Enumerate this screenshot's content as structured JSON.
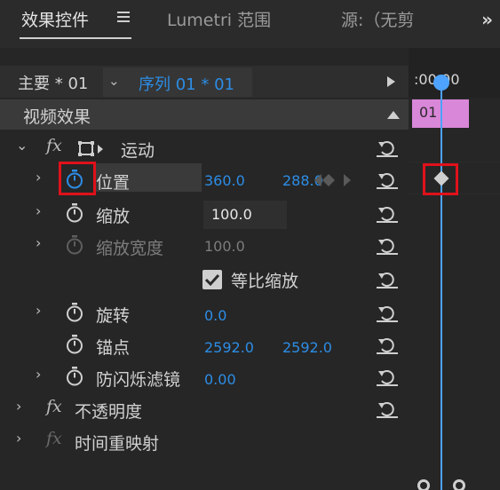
{
  "tabs": {
    "effect_controls": "效果控件",
    "lumetri": "Lumetri 范围",
    "source": "源:（无剪"
  },
  "sequence_bar": {
    "master": "主要 * 01",
    "sequence": "序列 01 * 01"
  },
  "video_effects": {
    "header": "视频效果",
    "motion": {
      "label": "运动",
      "properties": {
        "position": {
          "label": "位置",
          "x": "360.0",
          "y": "288.0"
        },
        "scale": {
          "label": "缩放",
          "value": "100.0"
        },
        "scale_width": {
          "label": "缩放宽度",
          "value": "100.0"
        },
        "uniform_scale": {
          "label": "等比缩放",
          "checked": true
        },
        "rotation": {
          "label": "旋转",
          "value": "0.0"
        },
        "anchor": {
          "label": "锚点",
          "x": "2592.0",
          "y": "2592.0"
        },
        "anti_flicker": {
          "label": "防闪烁滤镜",
          "value": "0.00"
        }
      }
    },
    "opacity": {
      "label": "不透明度"
    },
    "time_remap": {
      "label": "时间重映射"
    }
  },
  "timeline": {
    "timecode": ":00:00",
    "clip_label": "01"
  },
  "colors": {
    "accent_blue": "#2c8de6",
    "clip_pink": "#d987d9",
    "highlight_red": "#e0111b"
  }
}
